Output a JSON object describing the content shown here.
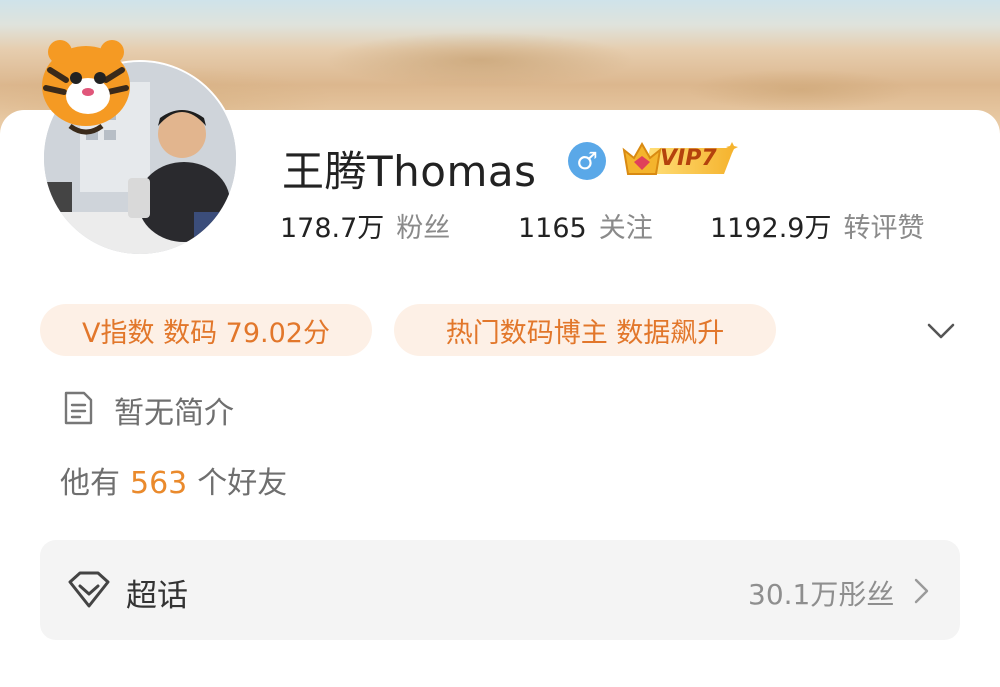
{
  "profile": {
    "name": "王腾Thomas",
    "gender_symbol": "♂",
    "vip_label": "VIP7"
  },
  "stats": [
    {
      "value": "178.7万",
      "label": "粉丝"
    },
    {
      "value": "1165",
      "label": "关注"
    },
    {
      "value": "1192.9万",
      "label": "转评赞"
    }
  ],
  "tags": [
    "V指数 数码 79.02分",
    "热门数码博主 数据飙升"
  ],
  "intro": {
    "text": "暂无简介",
    "friends_prefix": "他有",
    "friends_count": "563",
    "friends_suffix": "个好友"
  },
  "supertopic": {
    "label": "超话",
    "fans": "30.1万彤丝"
  },
  "colors": {
    "accent": "#e2772b",
    "tag_bg": "#fdf0e6",
    "gender": "#5aa8e8",
    "friends_count": "#ea8a2c"
  }
}
